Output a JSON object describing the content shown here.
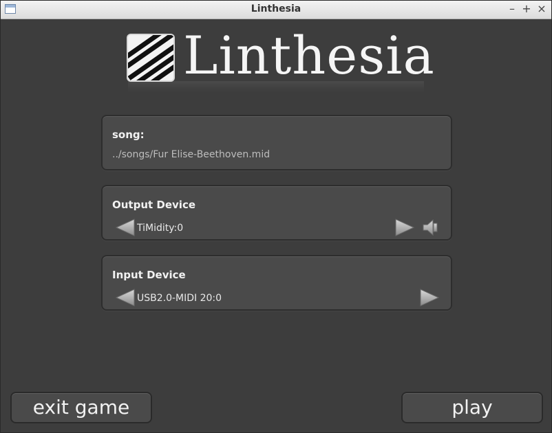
{
  "window": {
    "title": "Linthesia",
    "controls": {
      "minimize": "–",
      "maximize": "+",
      "close": "×"
    }
  },
  "logo": {
    "text": "Linthesia",
    "icon": "piano-keys-icon"
  },
  "song": {
    "heading": "song:",
    "path": "../songs/Fur Elise-Beethoven.mid"
  },
  "output_device": {
    "heading": "Output Device",
    "value": "TiMidity:0"
  },
  "input_device": {
    "heading": "Input Device",
    "value": "USB2.0-MIDI 20:0"
  },
  "buttons": {
    "exit": "exit game",
    "play": "play"
  },
  "colors": {
    "background": "#3d3d3d",
    "panel": "#4a4a4a",
    "text": "#f2f2f2"
  }
}
